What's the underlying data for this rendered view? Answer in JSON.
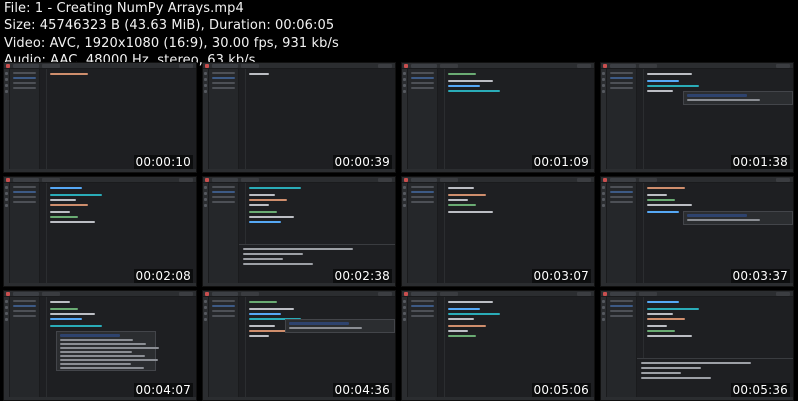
{
  "file_info": {
    "line1": "File: 1 - Creating NumPy Arrays.mp4",
    "line2": "Size: 45746323 B (43.63 MiB), Duration: 00:06:05",
    "line3": "Video: AVC, 1920x1080 (16:9), 30.00 fps, 931 kb/s",
    "line4": "Audio: AAC, 48000 Hz, stereo, 63 kb/s"
  },
  "thumbnails": [
    {
      "timestamp": "00:00:10",
      "code_lines": 1,
      "popup": false,
      "run_panel": false
    },
    {
      "timestamp": "00:00:39",
      "code_lines": 1,
      "popup": false,
      "run_panel": false
    },
    {
      "timestamp": "00:01:09",
      "code_lines": 4,
      "popup": false,
      "run_panel": false
    },
    {
      "timestamp": "00:01:38",
      "code_lines": 4,
      "popup": true,
      "run_panel": false
    },
    {
      "timestamp": "00:02:08",
      "code_lines": 7,
      "popup": false,
      "run_panel": false
    },
    {
      "timestamp": "00:02:38",
      "code_lines": 7,
      "popup": false,
      "run_panel": true
    },
    {
      "timestamp": "00:03:07",
      "code_lines": 5,
      "popup": false,
      "run_panel": false
    },
    {
      "timestamp": "00:03:37",
      "code_lines": 5,
      "popup": true,
      "run_panel": false
    },
    {
      "timestamp": "00:04:07",
      "code_lines": 5,
      "popup": true,
      "run_panel": false
    },
    {
      "timestamp": "00:04:36",
      "code_lines": 7,
      "popup": true,
      "run_panel": false
    },
    {
      "timestamp": "00:05:06",
      "code_lines": 7,
      "popup": false,
      "run_panel": false
    },
    {
      "timestamp": "00:05:36",
      "code_lines": 7,
      "popup": false,
      "run_panel": true
    }
  ],
  "theme": {
    "background": "#000000",
    "ide_background": "#1e1f22",
    "keyword_color": "#cf8e6d",
    "string_color": "#6aab73",
    "function_color": "#56a8f5"
  }
}
